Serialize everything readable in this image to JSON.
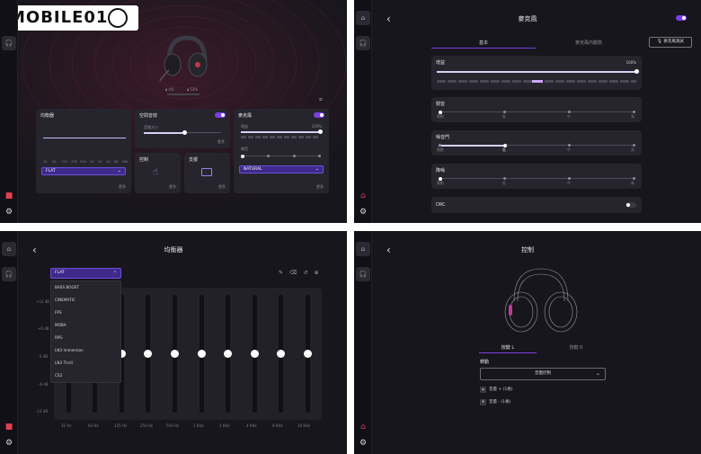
{
  "logo": {
    "text": "MOBILE01"
  },
  "p1": {
    "battery_left": "4%",
    "battery_right": "53%",
    "eq_card": {
      "title": "均衡器",
      "preset": "FLAT",
      "more": "更多",
      "freq_labels": [
        "31",
        "62",
        "125",
        "250",
        "500",
        "1K",
        "2K",
        "4K",
        "8K",
        "16K"
      ]
    },
    "spatial_card": {
      "title": "空間音效",
      "slider_label": "音場大小",
      "more": "更多"
    },
    "control_card": {
      "title": "控制",
      "more": "更多"
    },
    "support_card": {
      "title": "支援",
      "more": "更多"
    },
    "mic_card": {
      "title": "麥克風",
      "gain_label": "增益",
      "gain_value": "100%",
      "sidetone_label": "側音",
      "preset": "NATURAL",
      "more": "更多"
    }
  },
  "p2": {
    "title": "麥克風",
    "tab_basic": "基本",
    "tab_advanced": "麥克風內動態",
    "test_button": "麥克風測試",
    "gain": {
      "label": "增益",
      "value": "100%"
    },
    "sidetone": {
      "label": "側音",
      "ticks": [
        "關閉",
        "低",
        "中",
        "高"
      ]
    },
    "noise_gate": {
      "label": "噪音門",
      "ticks": [
        "關閉",
        "低",
        "中",
        "高"
      ]
    },
    "noise_reduction": {
      "label": "降噪",
      "ticks": [
        "關閉",
        "低",
        "中",
        "高"
      ]
    },
    "drc": {
      "label": "DRC"
    }
  },
  "p3": {
    "title": "均衡器",
    "preset": "FLAT",
    "presets": [
      "BASS BOOST",
      "CINEMATIC",
      "FPS",
      "MOBA",
      "RPG",
      "LN3 Immersion",
      "LN3 Thrill",
      "CS2"
    ],
    "y_labels": [
      "+12 dB",
      "+6 dB",
      "0 dB",
      "-6 dB",
      "-12 dB"
    ],
    "x_labels": [
      "31 Hz",
      "62 Hz",
      "125 Hz",
      "250 Hz",
      "500 Hz",
      "1 KHz",
      "2 KHz",
      "4 KHz",
      "8 KHz",
      "16 KHz"
    ],
    "band_gains_db": [
      0,
      0,
      0,
      0,
      0,
      0,
      0,
      0,
      0,
      0
    ]
  },
  "p4": {
    "title": "控制",
    "tab_left": "按鍵 L",
    "tab_right": "按鍵 R",
    "section_label": "轉動",
    "select_value": "音量控制",
    "rule_up": "音量 + (1格)",
    "rule_down": "音量 - (1格)"
  }
}
